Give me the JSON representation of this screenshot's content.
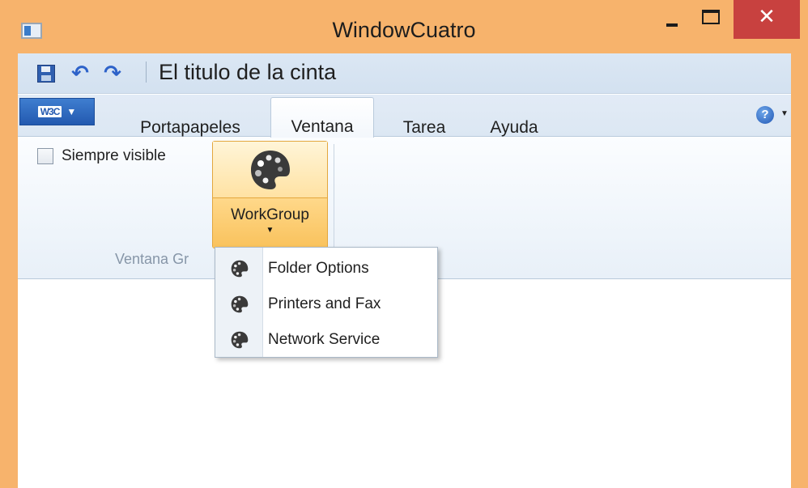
{
  "window": {
    "title": "WindowCuatro",
    "close_glyph": "✕",
    "colors": {
      "frame": "#f7b36c",
      "close": "#c8413f"
    }
  },
  "quick_access": {
    "undo_glyph": "↶",
    "redo_glyph": "↷",
    "ribbon_title": "El titulo de la cinta"
  },
  "ribbon": {
    "app_menu_logo": "W3C",
    "app_menu_arrow": "▼",
    "tabs": [
      {
        "label": "Portapapeles"
      },
      {
        "label": "Ventana",
        "selected": true
      },
      {
        "label": "Tarea"
      },
      {
        "label": "Ayuda"
      }
    ],
    "help_glyph": "?",
    "help_arrow": "▼",
    "group": {
      "checkbox_label": "Siempre visible",
      "checkbox_checked": false,
      "button_label": "WorkGroup",
      "button_arrow": "▼",
      "group_label": "Ventana Gr"
    }
  },
  "dropdown": {
    "items": [
      {
        "label": "Folder Options",
        "icon": "palette-icon"
      },
      {
        "label": "Printers and Fax",
        "icon": "palette-icon"
      },
      {
        "label": "Network Service",
        "icon": "palette-icon"
      }
    ]
  }
}
